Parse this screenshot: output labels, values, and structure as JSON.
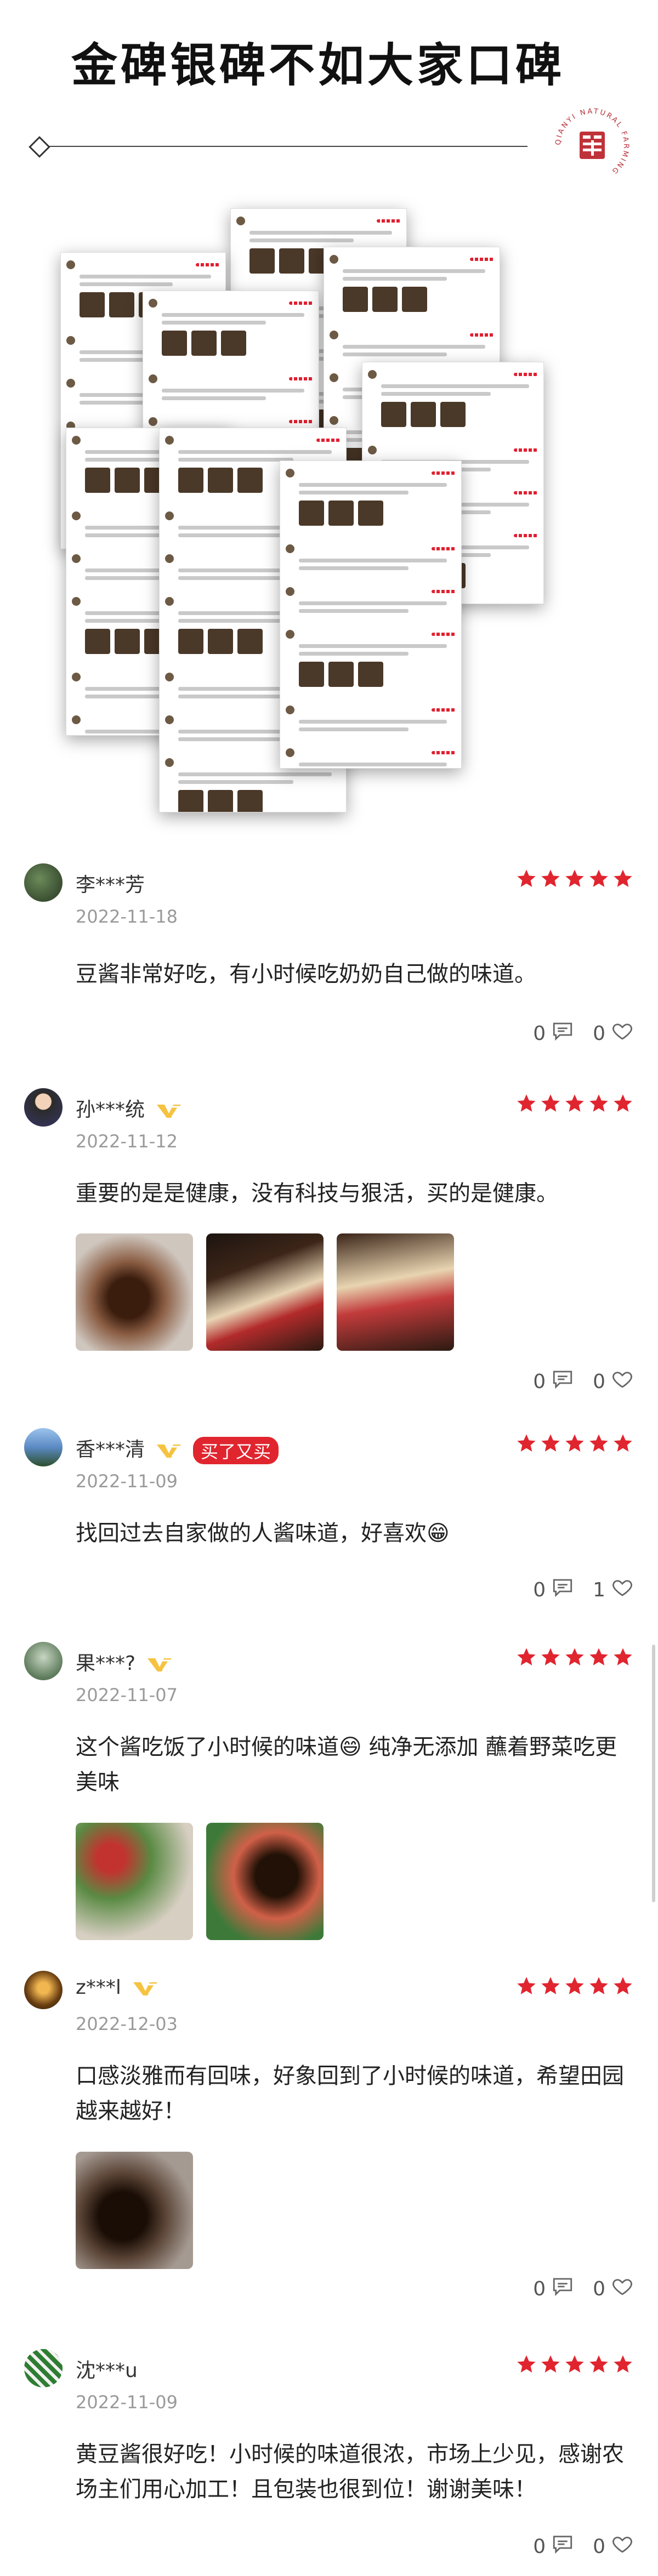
{
  "header": {
    "title": "金碑银碑不如大家口碑",
    "seal_text": "QIANYI NATURAL FARMING"
  },
  "colors": {
    "accent_red": "#e0252f",
    "text_dark": "#222222",
    "text_muted": "#9a9a9a"
  },
  "reviews": [
    {
      "user": "李***芳",
      "date": "2022-11-18",
      "rating": 5,
      "text": "豆酱非常好吃，有小时候吃奶奶自己做的味道。",
      "comment_count": "0",
      "like_count": "0",
      "vip": false,
      "rebuy_badge": ""
    },
    {
      "user": "孙***统",
      "date": "2022-11-12",
      "rating": 5,
      "text": "重要的是是健康，没有科技与狠活，买的是健康。",
      "comment_count": "0",
      "like_count": "0",
      "vip": true,
      "rebuy_badge": ""
    },
    {
      "user": "香***清",
      "date": "2022-11-09",
      "rating": 5,
      "text": "找回过去自家做的人酱味道，好喜欢😁",
      "comment_count": "0",
      "like_count": "1",
      "vip": true,
      "rebuy_badge": "买了又买"
    },
    {
      "user": "果***?",
      "date": "2022-11-07",
      "rating": 5,
      "text": "这个酱吃饭了小时候的味道😄 纯净无添加 蘸着野菜吃更美味",
      "comment_count": "",
      "like_count": "",
      "vip": true,
      "rebuy_badge": ""
    },
    {
      "user": "z***l",
      "date": "2022-12-03",
      "rating": 5,
      "text": "口感淡雅而有回味，好象回到了小时候的味道，希望田园越来越好！",
      "comment_count": "0",
      "like_count": "0",
      "vip": true,
      "rebuy_badge": ""
    },
    {
      "user": "沈***u",
      "date": "2022-11-09",
      "rating": 5,
      "text": "黄豆酱很好吃！小时候的味道很浓，市场上少见，感谢农场主们用心加工！且包装也很到位！谢谢美味！",
      "comment_count": "0",
      "like_count": "0",
      "vip": false,
      "rebuy_badge": ""
    }
  ]
}
